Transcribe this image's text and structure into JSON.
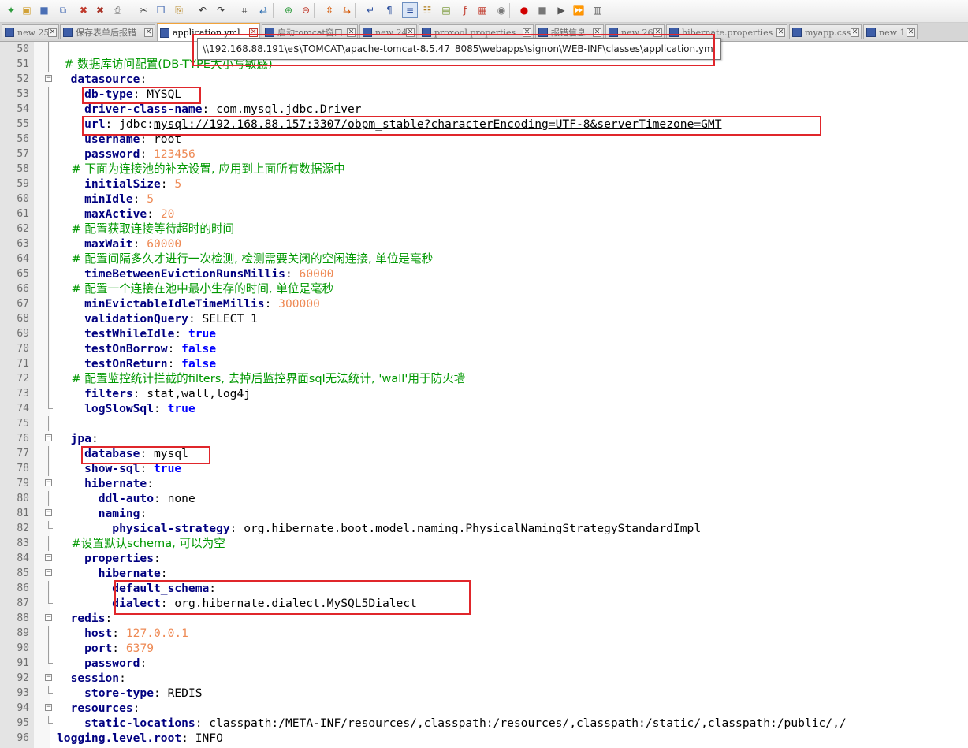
{
  "toolbar": {
    "buttons": [
      {
        "name": "new-file-icon",
        "glyph": "✦",
        "color": "#2d9b3c"
      },
      {
        "name": "open-file-icon",
        "glyph": "▣",
        "color": "#d1a136"
      },
      {
        "name": "save-icon",
        "glyph": "■",
        "color": "#4a6fb5"
      },
      {
        "name": "save-all-icon",
        "glyph": "⧉",
        "color": "#4a6fb5"
      },
      {
        "name": "close-icon",
        "glyph": "✖",
        "color": "#c0392b"
      },
      {
        "name": "close-all-icon",
        "glyph": "✖",
        "color": "#a93226"
      },
      {
        "name": "print-icon",
        "glyph": "⎙",
        "color": "#555555"
      },
      {
        "name": "cut-icon",
        "glyph": "✂",
        "color": "#444444"
      },
      {
        "name": "copy-icon",
        "glyph": "❐",
        "color": "#4a6fb5"
      },
      {
        "name": "paste-icon",
        "glyph": "⎘",
        "color": "#b98a2a"
      },
      {
        "name": "undo-icon",
        "glyph": "↶",
        "color": "#333333"
      },
      {
        "name": "redo-icon",
        "glyph": "↷",
        "color": "#333333"
      },
      {
        "name": "find-icon",
        "glyph": "⌗",
        "color": "#333333"
      },
      {
        "name": "replace-icon",
        "glyph": "⇄",
        "color": "#2b6cb0"
      },
      {
        "name": "zoom-in-icon",
        "glyph": "⊕",
        "color": "#2d9b3c"
      },
      {
        "name": "zoom-out-icon",
        "glyph": "⊖",
        "color": "#c0392b"
      },
      {
        "name": "sync-vertical-icon",
        "glyph": "⇳",
        "color": "#d35400"
      },
      {
        "name": "sync-horizontal-icon",
        "glyph": "⇆",
        "color": "#d35400"
      },
      {
        "name": "word-wrap-icon",
        "glyph": "↵",
        "color": "#2b4f9e"
      },
      {
        "name": "show-all-chars-icon",
        "glyph": "¶",
        "color": "#2b4f9e"
      },
      {
        "name": "indent-guide-icon",
        "glyph": "≡",
        "color": "#2b4f9e"
      },
      {
        "name": "user-language-icon",
        "glyph": "☷",
        "color": "#b07d1a"
      },
      {
        "name": "doc-map-icon",
        "glyph": "▤",
        "color": "#6b8e23"
      },
      {
        "name": "function-list-icon",
        "glyph": "ƒ",
        "color": "#c0392b"
      },
      {
        "name": "folder-workspace-icon",
        "glyph": "▦",
        "color": "#c0392b"
      },
      {
        "name": "monitoring-icon",
        "glyph": "◉",
        "color": "#777777"
      },
      {
        "name": "record-macro-icon",
        "glyph": "●",
        "color": "#d10000"
      },
      {
        "name": "stop-record-icon",
        "glyph": "■",
        "color": "#777777"
      },
      {
        "name": "playback-icon",
        "glyph": "▶",
        "color": "#555555"
      },
      {
        "name": "run-multiple-icon",
        "glyph": "⏩",
        "color": "#2b4f9e"
      },
      {
        "name": "save-macro-icon",
        "glyph": "▥",
        "color": "#555555"
      }
    ]
  },
  "tabs": [
    {
      "label": "new 25",
      "active": false,
      "cjk": false
    },
    {
      "label": "保存表单后报错",
      "active": false,
      "cjk": true
    },
    {
      "label": "application.yml",
      "active": true,
      "cjk": false
    },
    {
      "label": "启动tomcat窗口",
      "active": false,
      "cjk": true
    },
    {
      "label": "new 24",
      "active": false,
      "cjk": false
    },
    {
      "label": "proxool.properties",
      "active": false,
      "cjk": false
    },
    {
      "label": "报错信息",
      "active": false,
      "cjk": true
    },
    {
      "label": "new 26",
      "active": false,
      "cjk": false
    },
    {
      "label": "hibernate.properties",
      "active": false,
      "cjk": false
    },
    {
      "label": "myapp.css",
      "active": false,
      "cjk": false
    },
    {
      "label": "new 1",
      "active": false,
      "cjk": false
    }
  ],
  "tooltip": {
    "path": "\\\\192.168.88.191\\e$\\TOMCAT\\apache-tomcat-8.5.47_8085\\webapps\\signon\\WEB-INF\\classes\\application.yml"
  },
  "editor": {
    "lines": [
      {
        "no": "50",
        "tokens": [
          {
            "t": "",
            "c": "v"
          }
        ]
      },
      {
        "no": "51",
        "tokens": [
          {
            "t": "  # 数据库访问配置(DB-TYPE大小写敏感)",
            "c": "c"
          }
        ]
      },
      {
        "no": "52",
        "tokens": [
          {
            "t": "  datasource",
            "c": "k"
          },
          {
            "t": ":",
            "c": "v"
          }
        ]
      },
      {
        "no": "53",
        "tokens": [
          {
            "t": "    db-type",
            "c": "k"
          },
          {
            "t": ": MYSQL",
            "c": "v"
          }
        ]
      },
      {
        "no": "54",
        "tokens": [
          {
            "t": "    driver-class-name",
            "c": "k"
          },
          {
            "t": ": com.mysql.jdbc.Driver",
            "c": "v"
          }
        ]
      },
      {
        "no": "55",
        "tokens": [
          {
            "t": "    url",
            "c": "k"
          },
          {
            "t": ": jdbc:",
            "c": "v"
          },
          {
            "t": "mysql://192.168.88.157:3307/obpm_stable?characterEncoding=UTF-8&serverTimezone=GMT",
            "c": "v u"
          }
        ]
      },
      {
        "no": "56",
        "tokens": [
          {
            "t": "    username",
            "c": "k"
          },
          {
            "t": ": root",
            "c": "v"
          }
        ]
      },
      {
        "no": "57",
        "tokens": [
          {
            "t": "    password",
            "c": "k"
          },
          {
            "t": ": ",
            "c": "v"
          },
          {
            "t": "123456",
            "c": "n"
          }
        ]
      },
      {
        "no": "58",
        "tokens": [
          {
            "t": "    # 下面为连接池的补充设置, 应用到上面所有数据源中",
            "c": "c"
          }
        ]
      },
      {
        "no": "59",
        "tokens": [
          {
            "t": "    initialSize",
            "c": "k"
          },
          {
            "t": ": ",
            "c": "v"
          },
          {
            "t": "5",
            "c": "n"
          }
        ]
      },
      {
        "no": "60",
        "tokens": [
          {
            "t": "    minIdle",
            "c": "k"
          },
          {
            "t": ": ",
            "c": "v"
          },
          {
            "t": "5",
            "c": "n"
          }
        ]
      },
      {
        "no": "61",
        "tokens": [
          {
            "t": "    maxActive",
            "c": "k"
          },
          {
            "t": ": ",
            "c": "v"
          },
          {
            "t": "20",
            "c": "n"
          }
        ]
      },
      {
        "no": "62",
        "tokens": [
          {
            "t": "    # 配置获取连接等待超时的时间",
            "c": "c"
          }
        ]
      },
      {
        "no": "63",
        "tokens": [
          {
            "t": "    maxWait",
            "c": "k"
          },
          {
            "t": ": ",
            "c": "v"
          },
          {
            "t": "60000",
            "c": "n"
          }
        ]
      },
      {
        "no": "64",
        "tokens": [
          {
            "t": "    # 配置间隔多久才进行一次检测, 检测需要关闭的空闲连接, 单位是毫秒",
            "c": "c"
          }
        ]
      },
      {
        "no": "65",
        "tokens": [
          {
            "t": "    timeBetweenEvictionRunsMillis",
            "c": "k"
          },
          {
            "t": ": ",
            "c": "v"
          },
          {
            "t": "60000",
            "c": "n"
          }
        ]
      },
      {
        "no": "66",
        "tokens": [
          {
            "t": "    # 配置一个连接在池中最小生存的时间, 单位是毫秒",
            "c": "c"
          }
        ]
      },
      {
        "no": "67",
        "tokens": [
          {
            "t": "    minEvictableIdleTimeMillis",
            "c": "k"
          },
          {
            "t": ": ",
            "c": "v"
          },
          {
            "t": "300000",
            "c": "n"
          }
        ]
      },
      {
        "no": "68",
        "tokens": [
          {
            "t": "    validationQuery",
            "c": "k"
          },
          {
            "t": ": SELECT 1",
            "c": "v"
          }
        ]
      },
      {
        "no": "69",
        "tokens": [
          {
            "t": "    testWhileIdle",
            "c": "k"
          },
          {
            "t": ": ",
            "c": "v"
          },
          {
            "t": "true",
            "c": "b"
          }
        ]
      },
      {
        "no": "70",
        "tokens": [
          {
            "t": "    testOnBorrow",
            "c": "k"
          },
          {
            "t": ": ",
            "c": "v"
          },
          {
            "t": "false",
            "c": "b"
          }
        ]
      },
      {
        "no": "71",
        "tokens": [
          {
            "t": "    testOnReturn",
            "c": "k"
          },
          {
            "t": ": ",
            "c": "v"
          },
          {
            "t": "false",
            "c": "b"
          }
        ]
      },
      {
        "no": "72",
        "tokens": [
          {
            "t": "    # 配置监控统计拦截的filters, 去掉后监控界面sql无法统计, 'wall'用于防火墙",
            "c": "c"
          }
        ]
      },
      {
        "no": "73",
        "tokens": [
          {
            "t": "    filters",
            "c": "k"
          },
          {
            "t": ": stat,wall,log4j",
            "c": "v"
          }
        ]
      },
      {
        "no": "74",
        "tokens": [
          {
            "t": "    logSlowSql",
            "c": "k"
          },
          {
            "t": ": ",
            "c": "v"
          },
          {
            "t": "true",
            "c": "b"
          }
        ]
      },
      {
        "no": "75",
        "tokens": [
          {
            "t": "",
            "c": "v"
          }
        ]
      },
      {
        "no": "76",
        "tokens": [
          {
            "t": "  jpa",
            "c": "k"
          },
          {
            "t": ":",
            "c": "v"
          }
        ]
      },
      {
        "no": "77",
        "tokens": [
          {
            "t": "    database",
            "c": "k"
          },
          {
            "t": ": mysql",
            "c": "v"
          }
        ]
      },
      {
        "no": "78",
        "tokens": [
          {
            "t": "    show-sql",
            "c": "k"
          },
          {
            "t": ": ",
            "c": "v"
          },
          {
            "t": "true",
            "c": "b"
          }
        ]
      },
      {
        "no": "79",
        "tokens": [
          {
            "t": "    hibernate",
            "c": "k"
          },
          {
            "t": ":",
            "c": "v"
          }
        ]
      },
      {
        "no": "80",
        "tokens": [
          {
            "t": "      ddl-auto",
            "c": "k"
          },
          {
            "t": ": none",
            "c": "v"
          }
        ]
      },
      {
        "no": "81",
        "tokens": [
          {
            "t": "      naming",
            "c": "k"
          },
          {
            "t": ":",
            "c": "v"
          }
        ]
      },
      {
        "no": "82",
        "tokens": [
          {
            "t": "        physical-strategy",
            "c": "k"
          },
          {
            "t": ": org.hibernate.boot.model.naming.PhysicalNamingStrategyStandardImpl",
            "c": "v"
          }
        ]
      },
      {
        "no": "83",
        "tokens": [
          {
            "t": "    #设置默认schema, 可以为空",
            "c": "c"
          }
        ]
      },
      {
        "no": "84",
        "tokens": [
          {
            "t": "    properties",
            "c": "k"
          },
          {
            "t": ":",
            "c": "v"
          }
        ]
      },
      {
        "no": "85",
        "tokens": [
          {
            "t": "      hibernate",
            "c": "k"
          },
          {
            "t": ":",
            "c": "v"
          }
        ]
      },
      {
        "no": "86",
        "tokens": [
          {
            "t": "        default_schema",
            "c": "k"
          },
          {
            "t": ":",
            "c": "v"
          }
        ]
      },
      {
        "no": "87",
        "tokens": [
          {
            "t": "        dialect",
            "c": "k"
          },
          {
            "t": ": org.hibernate.dialect.MySQL5Dialect",
            "c": "v"
          }
        ]
      },
      {
        "no": "88",
        "tokens": [
          {
            "t": "  redis",
            "c": "k"
          },
          {
            "t": ":",
            "c": "v"
          }
        ]
      },
      {
        "no": "89",
        "tokens": [
          {
            "t": "    host",
            "c": "k"
          },
          {
            "t": ": ",
            "c": "v"
          },
          {
            "t": "127.0.0.1",
            "c": "n"
          }
        ]
      },
      {
        "no": "90",
        "tokens": [
          {
            "t": "    port",
            "c": "k"
          },
          {
            "t": ": ",
            "c": "v"
          },
          {
            "t": "6379",
            "c": "n"
          }
        ]
      },
      {
        "no": "91",
        "tokens": [
          {
            "t": "    password",
            "c": "k"
          },
          {
            "t": ":",
            "c": "v"
          }
        ]
      },
      {
        "no": "92",
        "tokens": [
          {
            "t": "  session",
            "c": "k"
          },
          {
            "t": ":",
            "c": "v"
          }
        ]
      },
      {
        "no": "93",
        "tokens": [
          {
            "t": "    store-type",
            "c": "k"
          },
          {
            "t": ": REDIS",
            "c": "v"
          }
        ]
      },
      {
        "no": "94",
        "tokens": [
          {
            "t": "  resources",
            "c": "k"
          },
          {
            "t": ":",
            "c": "v"
          }
        ]
      },
      {
        "no": "95",
        "tokens": [
          {
            "t": "    static-locations",
            "c": "k"
          },
          {
            "t": ": classpath:/META-INF/resources/,classpath:/resources/,classpath:/static/,classpath:/public/,/",
            "c": "v"
          }
        ]
      },
      {
        "no": "96",
        "tokens": [
          {
            "t": "logging.level.root",
            "c": "k"
          },
          {
            "t": ": INFO",
            "c": "v"
          }
        ]
      }
    ]
  }
}
